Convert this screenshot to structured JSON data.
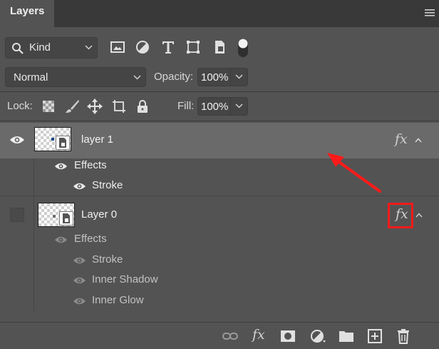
{
  "panel": {
    "tab_label": "Layers"
  },
  "filter": {
    "kind_label": "Kind"
  },
  "blend": {
    "mode": "Normal",
    "opacity_label": "Opacity:",
    "opacity_value": "100%"
  },
  "lock": {
    "label": "Lock:",
    "fill_label": "Fill:",
    "fill_value": "100%"
  },
  "layers": [
    {
      "name": "layer 1",
      "fx": "fx",
      "selected": true,
      "visible": true,
      "effects_label": "Effects",
      "effects": [
        "Stroke"
      ]
    },
    {
      "name": "Layer 0",
      "fx": "fx",
      "selected": false,
      "visible": false,
      "effects_label": "Effects",
      "effects": [
        "Stroke",
        "Inner Shadow",
        "Inner Glow"
      ]
    }
  ],
  "toolbar": {
    "fx_label": "fx"
  },
  "colors": {
    "panel_bg": "#535353",
    "selected_row": "#6a6a6a",
    "annotation_red": "#ff1a1a"
  }
}
